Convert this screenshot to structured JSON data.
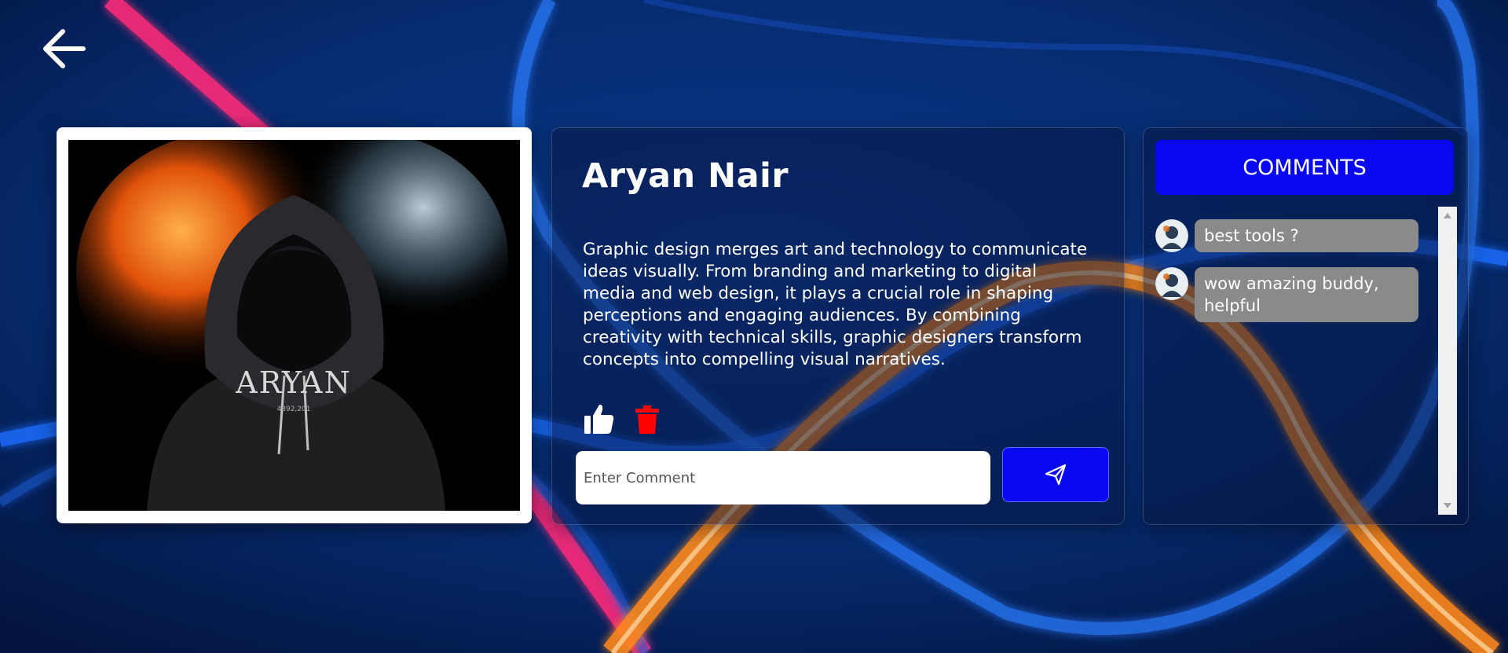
{
  "post": {
    "author": "Aryan Nair",
    "body": "Graphic design merges art and technology to communicate ideas visually. From branding and marketing to digital media and web design, it plays a crucial role in shaping perceptions and engaging audiences. By combining creativity with technical skills, graphic designers transform concepts into compelling visual narratives.",
    "image_text": "ARYAN",
    "image_subtext": "4892,201",
    "comment_placeholder": "Enter Comment"
  },
  "comments": {
    "header": "COMMENTS",
    "items": [
      {
        "text": "best tools ?"
      },
      {
        "text": "wow amazing buddy, helpful"
      }
    ]
  },
  "colors": {
    "accent": "#0707f0",
    "like": "#ffffff",
    "delete": "#ff0000",
    "bubble": "#8a8a8a"
  },
  "icons": {
    "back": "arrow-left-icon",
    "like": "thumbs-up-icon",
    "delete": "trash-icon",
    "send": "send-icon",
    "avatar": "avatar-icon"
  }
}
